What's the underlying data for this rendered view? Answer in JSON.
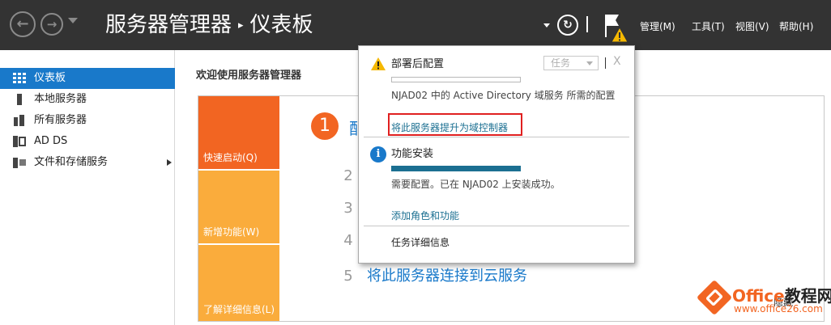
{
  "header": {
    "breadcrumb_root": "服务器管理器",
    "breadcrumb_current": "仪表板",
    "separator": "▸",
    "menus": [
      "管理(M)",
      "工具(T)",
      "视图(V)",
      "帮助(H)"
    ]
  },
  "sidebar": {
    "items": [
      {
        "label": "仪表板",
        "icon": "dashboard-icon",
        "active": true
      },
      {
        "label": "本地服务器",
        "icon": "server-icon"
      },
      {
        "label": "所有服务器",
        "icon": "servers-icon"
      },
      {
        "label": "AD DS",
        "icon": "ad-ds-icon"
      },
      {
        "label": "文件和存储服务",
        "icon": "file-storage-icon",
        "has_submenu": true
      }
    ]
  },
  "main": {
    "title": "欢迎使用服务器管理器",
    "tiles": [
      "快速启动(Q)",
      "新增功能(W)",
      "了解详细信息(L)"
    ],
    "steps": {
      "s1_num": "1",
      "s1_text": "配",
      "s2_num": "2",
      "s3_num": "3",
      "s4_num": "4",
      "s5_num": "5",
      "s5_text": "将此服务器连接到云服务"
    },
    "hide_label": "隐藏"
  },
  "notification": {
    "item1": {
      "title": "部署后配置",
      "task_label": "任务",
      "close": "X",
      "message": "NJAD02 中的 Active Directory 域服务 所需的配置",
      "link": "将此服务器提升为域控制器",
      "progress": 0
    },
    "item2": {
      "title": "功能安装",
      "message": "需要配置。已在 NJAD02 上安装成功。",
      "link": "添加角色和功能",
      "progress": 1
    },
    "footer": "任务详细信息"
  },
  "watermark": {
    "title_latin": "Office",
    "title_cn": "教程网",
    "url": "www.office26.com"
  },
  "colors": {
    "header_bg": "#333333",
    "accent_blue": "#1979ca",
    "tile_orange": "#f26522",
    "tile_light_orange": "#faac3c",
    "link_teal": "#1b6f91",
    "highlight_red": "#e02020"
  }
}
